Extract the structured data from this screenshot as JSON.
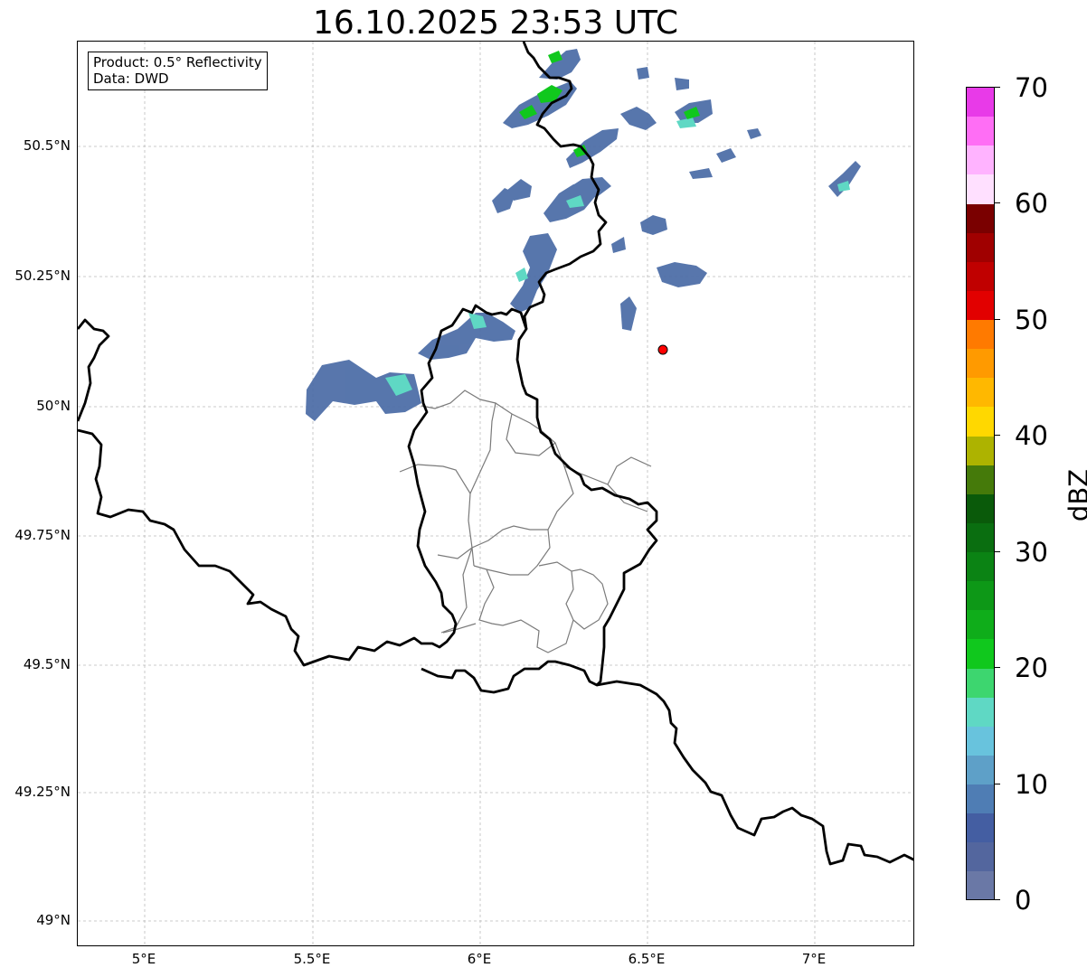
{
  "title": "16.10.2025 23:53 UTC",
  "info": {
    "product": "Product: 0.5° Reflectivity",
    "data": "Data: DWD"
  },
  "axes": {
    "lat_labels": [
      "50.5°N",
      "50.25°N",
      "50°N",
      "49.75°N",
      "49.5°N",
      "49.25°N",
      "49°N"
    ],
    "lon_labels": [
      "5°E",
      "5.5°E",
      "6°E",
      "6.5°E",
      "7°E"
    ]
  },
  "colorbar": {
    "label": "dBZ",
    "ticks": [
      "70",
      "60",
      "50",
      "40",
      "30",
      "20",
      "10",
      "0"
    ],
    "colors_top_to_bottom": [
      "#e83ae8",
      "#ff6ef5",
      "#ffb3ff",
      "#ffe0ff",
      "#7a0000",
      "#a00000",
      "#c00000",
      "#e20000",
      "#ff7a00",
      "#ff9a00",
      "#ffb800",
      "#ffd800",
      "#adb300",
      "#457a0a",
      "#0a5a0a",
      "#0a6e10",
      "#0b8314",
      "#0d9817",
      "#0fad1a",
      "#10c81d",
      "#3dd66f",
      "#5fd8c4",
      "#68c3dd",
      "#5ea0c8",
      "#4f7db4",
      "#445ea2",
      "#53669e",
      "#6a78a6"
    ]
  },
  "radar_site_marker": "red-circle"
}
